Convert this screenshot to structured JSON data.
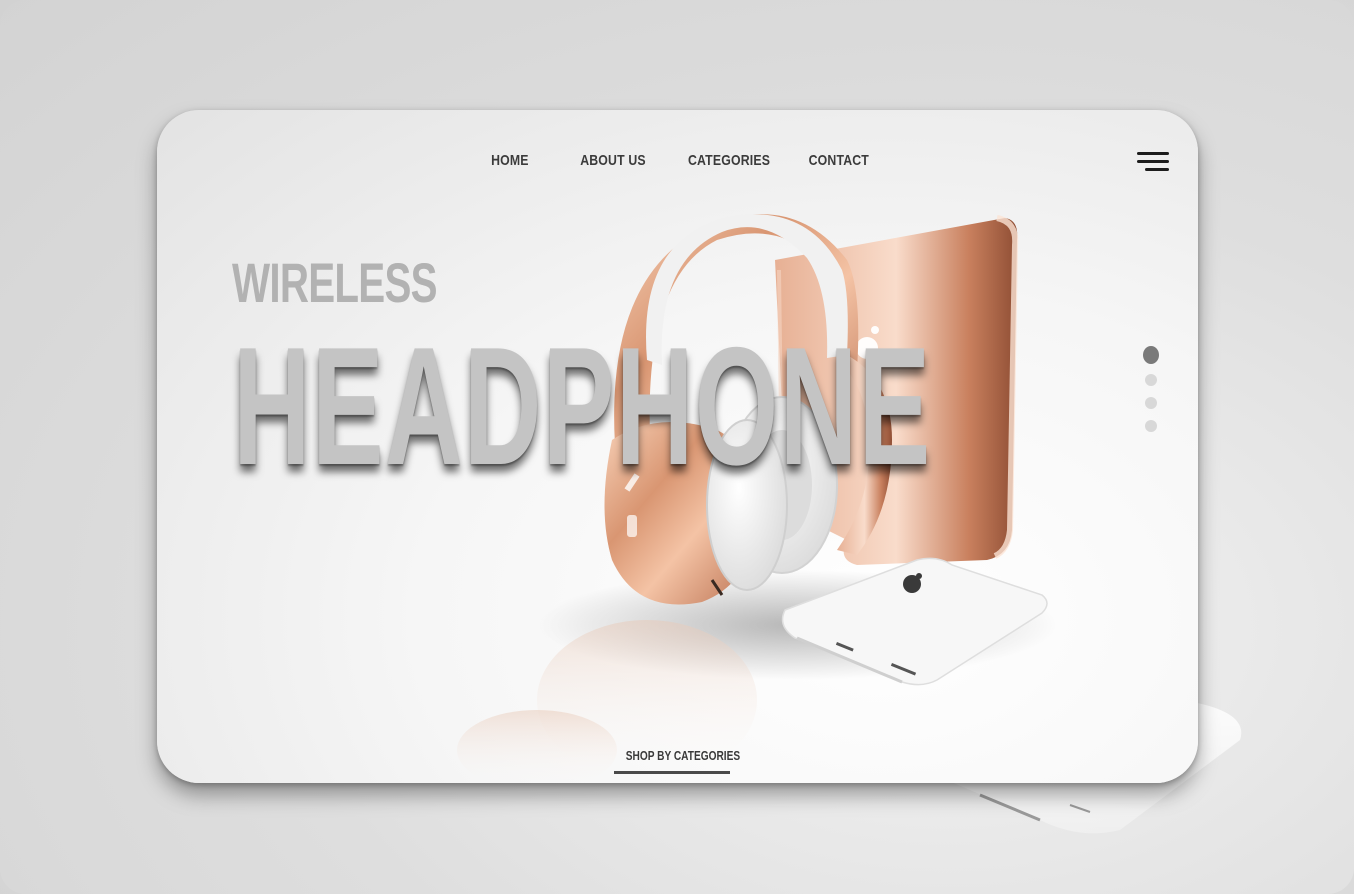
{
  "nav": {
    "home": "HOME",
    "about": "ABOUT US",
    "categories": "CATEGORIES",
    "contact": "CONTACT"
  },
  "hero": {
    "subtitle": "WIRELESS",
    "title": "HEADPHONE"
  },
  "cta": {
    "label": "SHOP BY CATEGORIES"
  },
  "slider": {
    "count": 4,
    "active": 1
  },
  "icons": {
    "menu": "hamburger-menu-icon"
  },
  "colors": {
    "accent_rose_gold": "#e0a27e",
    "text_dark": "#3b3b3b",
    "title_gray": "#c4c4c4"
  }
}
